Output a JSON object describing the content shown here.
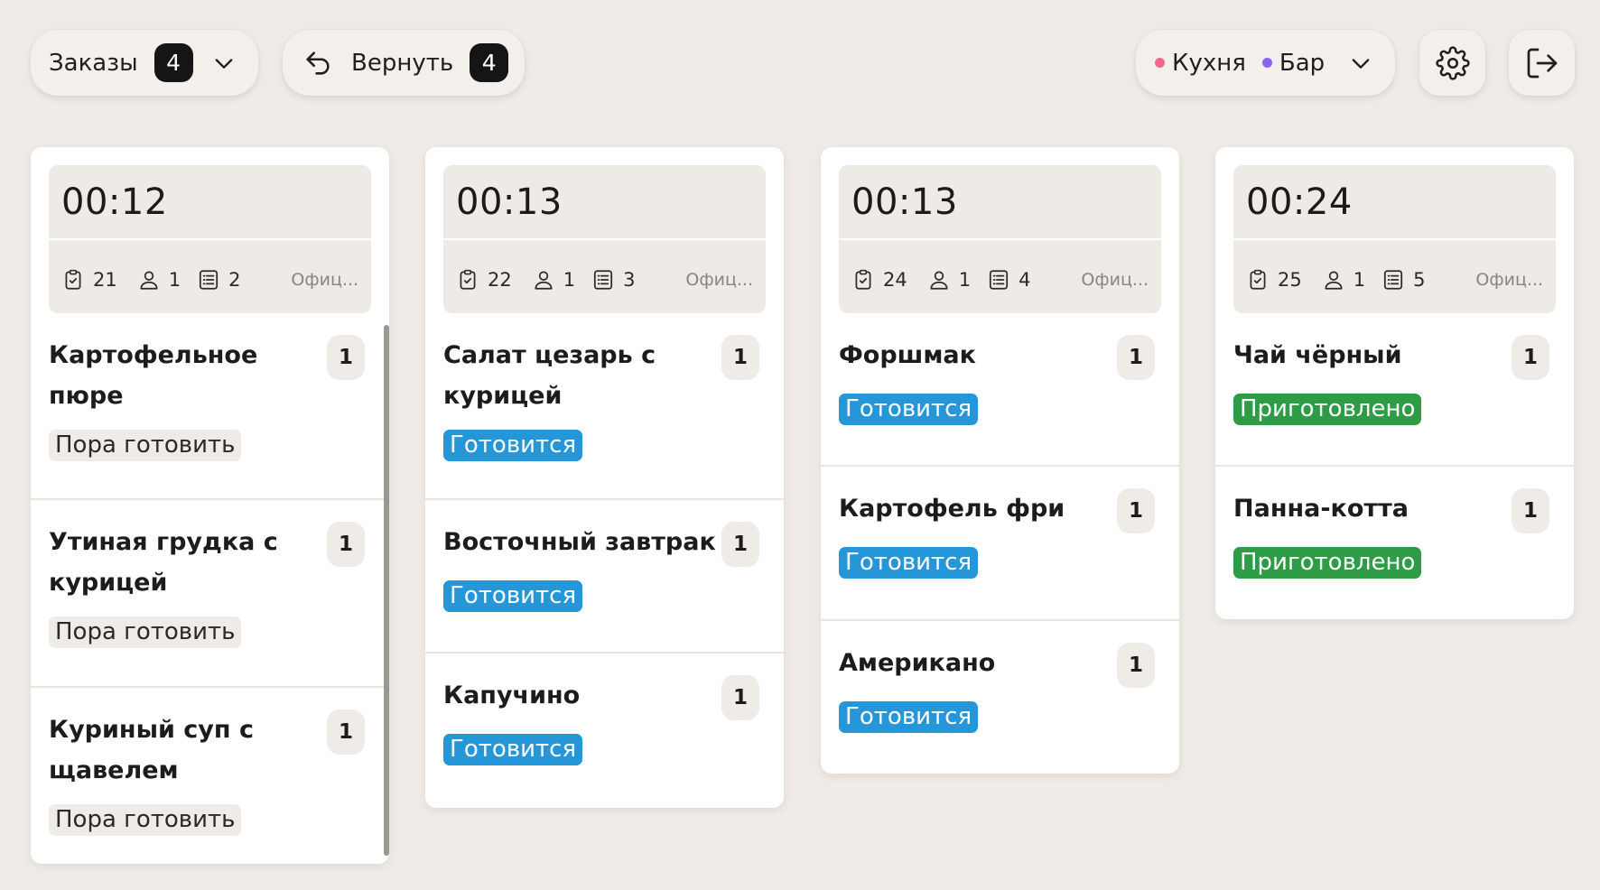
{
  "header": {
    "orders": {
      "label": "Заказы",
      "count": "4"
    },
    "return": {
      "label": "Вернуть",
      "count": "4"
    },
    "stations": {
      "kitchen": "Кухня",
      "bar": "Бар"
    }
  },
  "colors": {
    "kitchen_dot": "#f0698c",
    "bar_dot": "#8a63f2",
    "status_wait": "#efebe6",
    "status_cooking": "#2596d8",
    "status_ready": "#2e9c45"
  },
  "orders": [
    {
      "time": "00:12",
      "order_no": "21",
      "guests": "1",
      "items_count": "2",
      "waiter": "Офиц...",
      "items": [
        {
          "name": "Картофельное пюре",
          "qty": "1",
          "status": "Пора готовить"
        },
        {
          "name": "Утиная грудка с курицей",
          "qty": "1",
          "status": "Пора готовить"
        },
        {
          "name": "Куриный суп с щавелем",
          "qty": "1",
          "status": "Пора готовить"
        }
      ]
    },
    {
      "time": "00:13",
      "order_no": "22",
      "guests": "1",
      "items_count": "3",
      "waiter": "Офиц...",
      "items": [
        {
          "name": "Салат цезарь с курицей",
          "qty": "1",
          "status": "Готовится"
        },
        {
          "name": "Восточный завтрак",
          "qty": "1",
          "status": "Готовится"
        },
        {
          "name": "Капучино",
          "qty": "1",
          "status": "Готовится"
        }
      ]
    },
    {
      "time": "00:13",
      "order_no": "24",
      "guests": "1",
      "items_count": "4",
      "waiter": "Офиц...",
      "items": [
        {
          "name": "Форшмак",
          "qty": "1",
          "status": "Готовится"
        },
        {
          "name": "Картофель фри",
          "qty": "1",
          "status": "Готовится"
        },
        {
          "name": "Американо",
          "qty": "1",
          "status": "Готовится"
        }
      ]
    },
    {
      "time": "00:24",
      "order_no": "25",
      "guests": "1",
      "items_count": "5",
      "waiter": "Офиц...",
      "items": [
        {
          "name": "Чай чёрный",
          "qty": "1",
          "status": "Приготовлено"
        },
        {
          "name": "Панна-котта",
          "qty": "1",
          "status": "Приготовлено"
        }
      ]
    }
  ]
}
